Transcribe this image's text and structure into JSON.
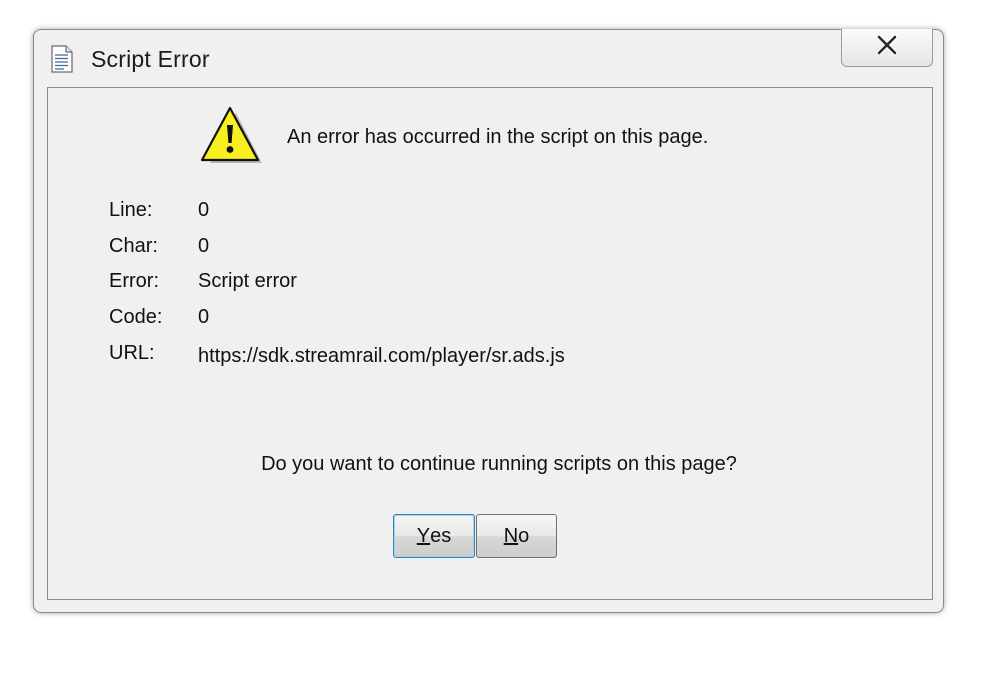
{
  "window": {
    "title": "Script Error",
    "close_glyph": "✕"
  },
  "icons": {
    "title_icon": "document-icon",
    "warning_icon": "warning-icon",
    "close_icon": "close-icon"
  },
  "message": {
    "headline": "An error has occurred in the script on this page.",
    "question": "Do you want to continue running scripts on this page?"
  },
  "details": [
    {
      "label": "Line:",
      "value": "0"
    },
    {
      "label": "Char:",
      "value": "0"
    },
    {
      "label": "Error:",
      "value": "Script error"
    },
    {
      "label": "Code:",
      "value": "0"
    },
    {
      "label": "URL:",
      "value": "https://sdk.streamrail.com/player/sr.ads.js"
    }
  ],
  "buttons": {
    "yes_mnemonic": "Y",
    "yes_rest": "es",
    "no_mnemonic": "N",
    "no_rest": "o"
  },
  "colors": {
    "warning_fill": "#f7ef1f",
    "window_bg": "#f0f0f0",
    "default_button_border": "#3c7fb1"
  }
}
